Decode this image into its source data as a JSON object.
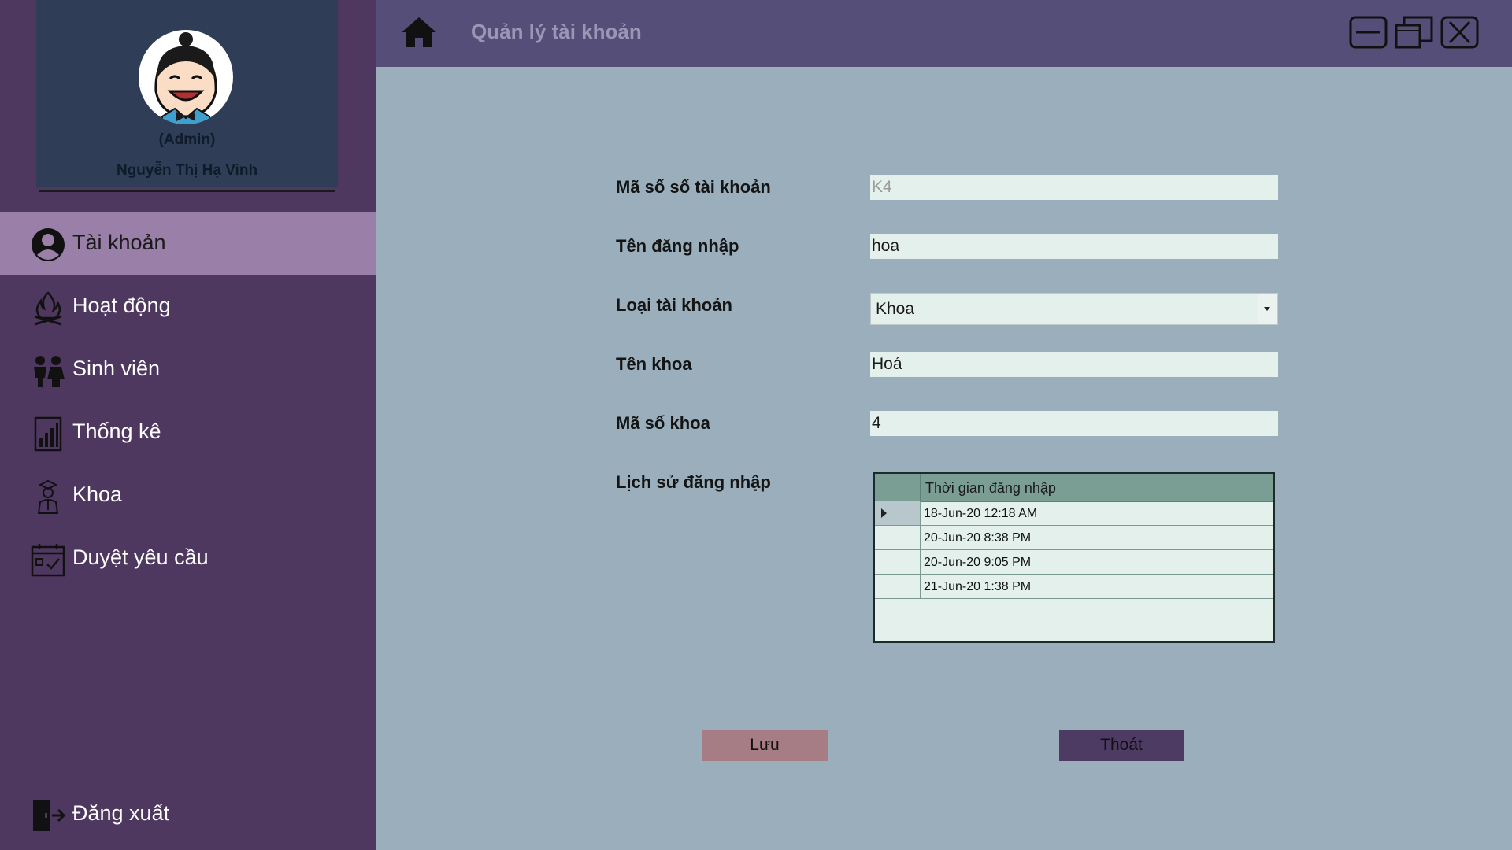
{
  "profile": {
    "role": "(Admin)",
    "name": "Nguyễn Thị Hạ Vinh"
  },
  "nav": {
    "items": [
      {
        "label": "Tài khoản",
        "icon": "user-circle-icon"
      },
      {
        "label": "Hoạt động",
        "icon": "campfire-icon"
      },
      {
        "label": "Sinh viên",
        "icon": "students-icon"
      },
      {
        "label": "Thống kê",
        "icon": "bar-chart-icon"
      },
      {
        "label": "Khoa",
        "icon": "graduate-icon"
      },
      {
        "label": "Duyệt yêu cầu",
        "icon": "calendar-check-icon"
      }
    ],
    "logout": {
      "label": "Đăng xuất",
      "icon": "logout-icon"
    }
  },
  "header": {
    "title": "Quản lý tài khoản"
  },
  "form": {
    "account_id": {
      "label": "Mã số số tài khoản",
      "value": "K4"
    },
    "username": {
      "label": "Tên đăng nhập",
      "value": "hoa"
    },
    "account_type": {
      "label": "Loại tài khoản",
      "value": "Khoa"
    },
    "faculty_name": {
      "label": "Tên khoa",
      "value": "Hoá"
    },
    "faculty_code": {
      "label": "Mã số khoa",
      "value": "4"
    },
    "login_history": {
      "label": "Lịch sử đăng nhập"
    }
  },
  "login_grid": {
    "column": "Thời gian đăng nhập",
    "rows": [
      "18-Jun-20 12:18 AM",
      "20-Jun-20 8:38 PM",
      "20-Jun-20 9:05 PM",
      "21-Jun-20 1:38 PM"
    ]
  },
  "buttons": {
    "save": "Lưu",
    "exit": "Thoát"
  },
  "colors": {
    "sidebar": "#4e3860",
    "sidebar_active": "#9a7fa8",
    "header": "#544e79",
    "content": "#9aaebb",
    "save_button": "#a67d85",
    "exit_button": "#4e3b63"
  }
}
